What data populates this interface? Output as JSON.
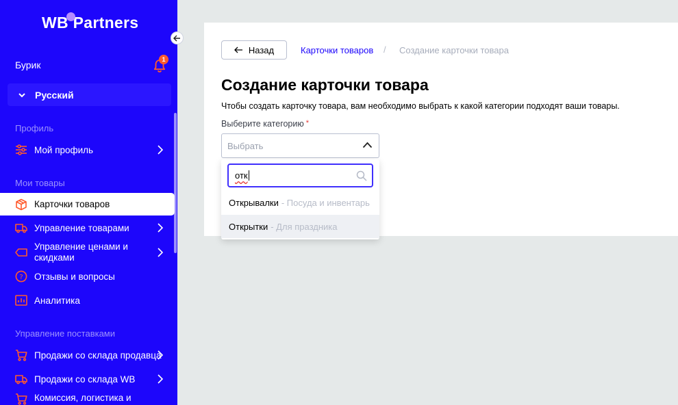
{
  "sidebar": {
    "logo_wb": "WB",
    "logo_partners": "Partners",
    "user_name": "Бурик",
    "notification_count": "1",
    "language": "Русский",
    "sections": {
      "profile": "Профиль",
      "my_goods": "Мои товары",
      "supplies": "Управление поставками"
    },
    "items": [
      {
        "label": "Мой профиль",
        "icon": "sliders-icon"
      },
      {
        "label": "Карточки товаров",
        "icon": "box-icon"
      },
      {
        "label": "Управление товарами",
        "icon": "truck-icon"
      },
      {
        "label": "Управление ценами и скидками",
        "icon": "price-tag-icon"
      },
      {
        "label": "Отзывы и вопросы",
        "icon": "question-circle-icon"
      },
      {
        "label": "Аналитика",
        "icon": "chart-icon"
      },
      {
        "label": "Продажи со склада продавца",
        "icon": "cart-icon"
      },
      {
        "label": "Продажи со склада WB",
        "icon": "truck-icon"
      },
      {
        "label": "Комиссия, логистика и",
        "icon": "cart-icon"
      }
    ],
    "accent": "#1d06fb",
    "icon_color": "#ff5a2d"
  },
  "breadcrumb": {
    "back_label": "Назад",
    "link": "Карточки товаров",
    "separator": "/",
    "current": "Создание карточки товара"
  },
  "main": {
    "title": "Создание карточки товара",
    "description": "Чтобы создать карточку товара, вам необходимо выбрать к какой категории подходят ваши товары.",
    "category_label": "Выберите категорию",
    "required_mark": "*",
    "select_placeholder": "Выбрать"
  },
  "dropdown": {
    "search_value": "отк",
    "options": [
      {
        "name": "Открывалки",
        "category": "- Посуда и инвентарь"
      },
      {
        "name": "Открытки",
        "category": "- Для праздника"
      }
    ]
  }
}
